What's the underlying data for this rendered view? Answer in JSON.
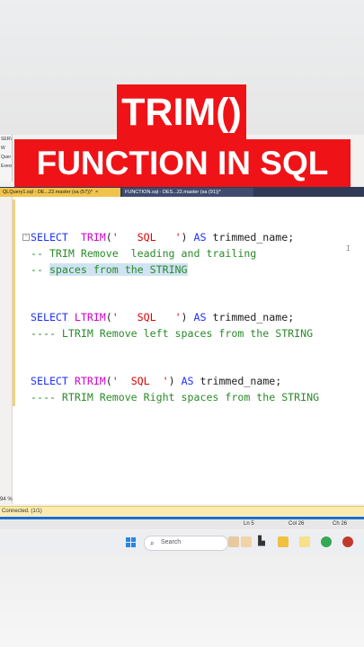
{
  "banner": {
    "line1": "TRIM()",
    "line2": "FUNCTION IN SQL"
  },
  "object_explorer": {
    "items": [
      "SERVE",
      "W",
      "Quer",
      "Execu"
    ]
  },
  "tabs": [
    {
      "label": "QLQuery1.sql - DE...22.master (sa (57))*",
      "close": "×"
    },
    {
      "label": "FUNCTION.sql - DES...22.master (sa (91))*",
      "close": ""
    }
  ],
  "code": {
    "l1": {
      "kw": "SELECT",
      "fn": "TRIM",
      "open": "(",
      "str": "'   SQL   '",
      "close": ")",
      "as": "AS",
      "alias": "trimmed_name;"
    },
    "l2": "-- TRIM Remove  leading and trailing",
    "l3a": "-- ",
    "l3b": "spaces from the STRING",
    "l4": {
      "kw": "SELECT",
      "fn": "LTRIM",
      "open": "(",
      "str": "'   SQL   '",
      "close": ")",
      "as": "AS",
      "alias": "trimmed_name;"
    },
    "l5": "---- LTRIM Remove left spaces from the STRING",
    "l6": {
      "kw": "SELECT",
      "fn": "RTRIM",
      "open": "(",
      "str": "'  SQL  '",
      "close": ")",
      "as": "AS",
      "alias": "trimmed_name;"
    },
    "l7": "---- RTRIM Remove Right spaces from the STRING"
  },
  "editor": {
    "zoom": "94 %",
    "cursor_glyph": "I"
  },
  "status": {
    "connection": "Connected. (1/1)",
    "ln": "Ln 5",
    "col": "Col 26",
    "ch": "Ch 26"
  },
  "taskbar": {
    "search_placeholder": "Search"
  },
  "colors": {
    "banner": "#ef1318",
    "keyword": "#1c30ff",
    "function": "#d000c8",
    "string": "#d80000",
    "comment": "#2a8a2a"
  }
}
